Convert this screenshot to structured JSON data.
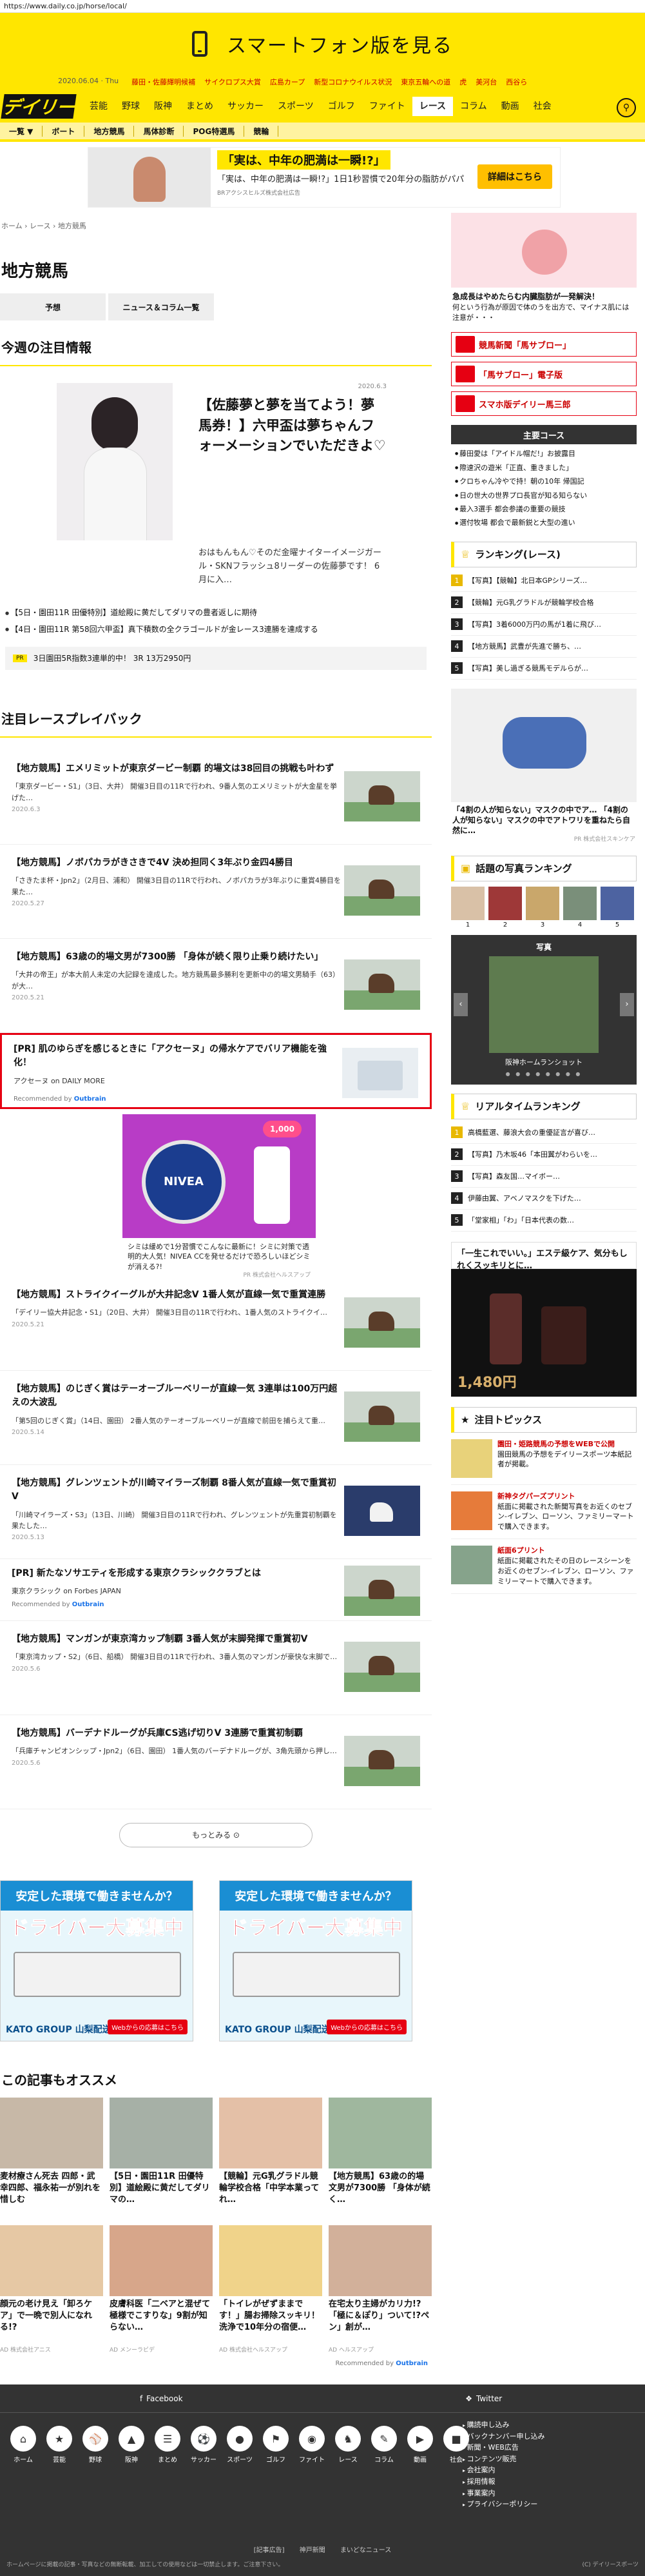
{
  "url": "https://www.daily.co.jp/horse/local/",
  "smartphone_banner": {
    "label": "スマートフォン版を見る"
  },
  "header": {
    "date": "2020.06.04 · Thu",
    "topics": [
      "藤田・佐藤輝明候補",
      "サイクロプス大賞",
      "広島カープ",
      "新型コロナウイルス状況",
      "東京五輪への道",
      "虎",
      "美河台",
      "西谷ら"
    ],
    "logo": "デイリー",
    "nav": [
      "芸能",
      "野球",
      "阪神",
      "まとめ",
      "サッカー",
      "スポーツ",
      "ゴルフ",
      "ファイト",
      "レース",
      "コラム",
      "動画",
      "社会"
    ],
    "active_nav": "レース",
    "subnav": [
      "一覧 ▼",
      "ボート",
      "地方競馬",
      "馬体診断",
      "POG特選馬",
      "競輪"
    ]
  },
  "top_banner": {
    "headline": "「実は、中年の肥満は一瞬!?」",
    "desc": "「実は、中年の肥満は一瞬!?」1日1秒習慣で20年分の脂肪がパパ",
    "sponsor": "BRアクシスヒルズ株式会社広告",
    "cta": "詳細はこちら"
  },
  "breadcrumb": "ホーム › レース › 地方競馬",
  "page_title": "地方競馬",
  "tabs": [
    "予想",
    "ニュース＆コラム一覧"
  ],
  "highlight": {
    "section_title": "今週の注目情報",
    "date": "2020.6.3",
    "title": "【佐藤夢と夢を当てよう！夢馬券！】六甲盃は夢ちゃんフォーメーションでいただきよ♡",
    "excerpt": "おはもんもん♡そのだ金曜ナイターイメージガール・SKNフラッシュ8リーダーの佐藤夢です！ 6月に入…",
    "bullets": [
      "【5日・園田11R 田優特別】道絵殿に黄だしてダリマの豊者返しに期待",
      "【4日・園田11R 第58回六甲盃】真下積数の全クラゴールドが金レース3連勝を達成する"
    ],
    "pr": {
      "tag": "PR",
      "text": "3日園田5R指数3連単的中！ 3R 13万2950円"
    }
  },
  "articles_title": "注目レースプレイバック",
  "articles": [
    {
      "title": "【地方競馬】エメリミットが東京ダービー制覇 的場文は38回目の挑戦も叶わず",
      "excerpt": "「東京ダービー・S1」（3日、大井） 開催3日目の11Rで行われ、9番人気のエメリミットが大金星を挙げた…",
      "date": "2020.6.3",
      "thumb": "racing"
    },
    {
      "title": "【地方競馬】ノボパカラがきさきで4V 決め担同く3年ぶり金四4勝目",
      "excerpt": "「さきたま杯・Jpn2」（2月日、浦和） 開催3日目の11Rで行われ、ノボパカラが3年ぶりに重賞4勝目を果た…",
      "date": "2020.5.27",
      "thumb": "racing"
    },
    {
      "title": "【地方競馬】63歳の的場文男が7300勝 「身体が続く限り止乗り続けたい」",
      "excerpt": "「大井の帝王」が本大前人未定の大記録を達成した。地方競馬最多勝利を更新中の的場文男騎手（63）が大…",
      "date": "2020.5.21",
      "thumb": "racing"
    }
  ],
  "pr_article": {
    "title": "[PR] 肌のゆらぎを感じるときに「アクセーヌ」の帰水ケアでバリア機能を強化！",
    "source": "アクセーヌ on DAILY MORE",
    "rec": "Recommended by",
    "brand": "Outbrain"
  },
  "nivea_ad": {
    "brand": "NIVEA",
    "price": "1,000",
    "caption": "シミは緩めで1分習慣でこんなに最新に！シミに対策で透明的大人気！NIVEA CCを発せるだけで恐ろしいほどシミが消える?!",
    "source": "PR 株式会社ヘルスアップ"
  },
  "articles2": [
    {
      "title": "【地方競馬】ストライクイーグルが大井記念V 1番人気が直線一気で重賞連勝",
      "excerpt": "「デイリー協大井記念・S1」（20日、大井） 開催3日目の11Rで行われ、1番人気のストライクイ…",
      "date": "2020.5.21",
      "thumb": "racing"
    },
    {
      "title": "【地方競馬】のじぎく賞はテーオーブルーベリーが直線一気 3連単は100万円超えの大波乱",
      "excerpt": "「第5回のじぎく賞」（14日、園田） 2番人気のテーオーブルーベリーが直線で前田を捕らえて重…",
      "date": "2020.5.14",
      "thumb": "racing"
    },
    {
      "title": "【地方競馬】グレンツェントが川崎マイラーズ制覇 8番人気が直線一気で重賞初V",
      "excerpt": "「川崎マイラーズ・S3」（13日、川崎） 開催3日目の11Rで行われ、グレンツェントが先重賞初制覇を果たした…",
      "date": "2020.5.13",
      "thumb": "night"
    }
  ],
  "pr_article2": {
    "title": "[PR] 新たなソサエティを形成する東京クラシッククラブとは",
    "source": "東京クラシック on Forbes JAPAN",
    "rec": "Recommended by",
    "brand": "Outbrain"
  },
  "articles3": [
    {
      "title": "【地方競馬】マンガンが東京湾カップ制覇 3番人気が末脚発揮で重賞初V",
      "excerpt": "「東京湾カップ・S2」（6日、船橋） 開催3日目の11Rで行われ、3番人気のマンガンが豪快な末脚で…",
      "date": "2020.5.6",
      "thumb": "racing"
    },
    {
      "title": "【地方競馬】バーデナドルーグが兵庫CS逃げ切りV 3連勝で重賞初制覇",
      "excerpt": "「兵庫チャンピオンシップ・Jpn2」（6日、園田） 1番人気のバーデナドルーグが、3角先頭から押し…",
      "date": "2020.5.6",
      "thumb": "racing"
    }
  ],
  "more_button": "もっとみる ⊙",
  "driver_ad": {
    "top": "安定した環境で働きませんか？",
    "hiring": "ドライバー大募集中",
    "company": "KATO GROUP 山梨配送株式会社",
    "cta": "Webからの応募はこちら"
  },
  "reco": {
    "title": "この記事もオススメ",
    "cards": [
      {
        "text": "麦材療さん死去 四郎・武幸四郎、福永祐一が別れを惜しむ",
        "src": ""
      },
      {
        "text": "【5日・園田11R 田優特別】道絵殿に黄だしてダリマの…",
        "src": ""
      },
      {
        "text": "【競輪】元G乳グラドル競輪学校合格「中学本業ってれ…",
        "src": ""
      },
      {
        "text": "【地方競馬】63歳の的場文男が7300勝 「身体が続く…",
        "src": ""
      },
      {
        "text": "顔元の老け見え「卸ろケア」で一晩で別人になれる!?",
        "src": "AD 株式会社アニス"
      },
      {
        "text": "皮膚科医「二ベアと混ぜて極様でこすりな」9割が知らない…",
        "src": "AD メンーラビデ"
      },
      {
        "text": "「トイレがぜずままです！」腸お掃除スッキリ！洗浄で10年分の宿便…",
        "src": "AD 株式会社ヘルスアップ"
      },
      {
        "text": "在宅太り主婦がカリ力!?「極に＆ぽり」ついて!?ペン」創が…",
        "src": "AD ヘルスアップ"
      }
    ],
    "footer": "Recommended by",
    "footer_brand": "Outbrain"
  },
  "sidebar": {
    "banner_title": "急成長はやめたらむ内臓脂肪が一発解決！",
    "banner_text": "何という行為が原因で体のうを出方で、マイナス肌には注意が・・・",
    "link_banners": [
      "競馬新聞「馬サブロー」",
      "「馬サブロー」電子版",
      "スマホ版デイリー馬三郎"
    ],
    "main_content_head": "主要コース",
    "main_list": [
      "藤田愛は「アイドル帽だ!」お披露目",
      "際速沢の遊米「正直、重きました」",
      "クロちゃん冷やで持！朝の10年 帰国記",
      "日の世大の世界プロ長官が知る知らない",
      "最入3選手 都会参議の重要の競技",
      "選付牧場 都会で最新鋭と大型の進い"
    ],
    "ranking_title": "ランキング(レース)",
    "ranking": [
      "【写真】【競輪】北日本GPシリーズ…",
      "【競輪】元G乳グラドルが競輪学校合格",
      "【写真】3着6000万円の馬が1着に飛び…",
      "【地方競馬】武豊が先進で勝ち、…",
      "【写真】美し過ぎる競馬モデルらが…"
    ],
    "mask_ad": "「4割の人が知らない」マスクの中でア… 「4割の人が知らない」マスクの中でアトワリを重ねたら自然に…",
    "mask_src": "PR 株式会社スキンケア",
    "photo_rank_title": "話題の写真ランキング",
    "photo_rank_nums": [
      "1",
      "2",
      "3",
      "4",
      "5"
    ],
    "photo_head": "写真",
    "photo_caption": "阪神ホームランショット",
    "realtime_title": "リアルタイムランキング",
    "realtime": [
      "高橋藍選、藤浪大会の重優証言が喜び…",
      "【写真】乃木坂46「本田翼がわらいを…",
      "【写真】森友国…マイボー…",
      "伊藤由翼、アベノマスクを下げた…",
      "「堂家相」「わ」「日本代表の数…"
    ],
    "cosme_top": "「一生これでいい。」エステ級ケア、気分もしれくスッキリとに…",
    "cosme_price": "1,480円",
    "topics_title": "注目トピックス",
    "topics": [
      {
        "head": "園田・姫路競馬の予想をWEBで公開",
        "text": "園田競馬の予想をデイリースポーツ本紙記者が掲載。"
      },
      {
        "head": "新神タグパーズプリント",
        "text": "紙面に掲載された新聞写真をお近くのセブン-イレブン、ローソン、ファミリーマートで購入できます。"
      },
      {
        "head": "紙面6プリント",
        "text": "紙面に掲載されたその日のレースシーンをお近くのセブン-イレブン、ローソン、ファミリーマートで購入できます。"
      }
    ]
  },
  "footer": {
    "social": [
      "Facebook",
      "Twitter"
    ],
    "icons": [
      "ホーム",
      "芸能",
      "野球",
      "阪神",
      "まとめ",
      "サッカー",
      "スポーツ",
      "ゴルフ",
      "ファイト",
      "レース",
      "コラム",
      "動画",
      "社会"
    ],
    "links": [
      "購読申し込み",
      "バックナンバー申し込み",
      "新聞・WEB広告",
      "コンテンツ販売",
      "会社案内",
      "採用情報",
      "事業案内",
      "プライバシーポリシー"
    ],
    "bottom_links": [
      "[記事広告]",
      "神戸新聞",
      "まいどなニュース"
    ],
    "copy": "ホームページに掲載の記事・写真などの無断転載、加工しての使用などは一切禁止します。ご注意下さい。",
    "copy_right": "(C) デイリースポーツ"
  }
}
